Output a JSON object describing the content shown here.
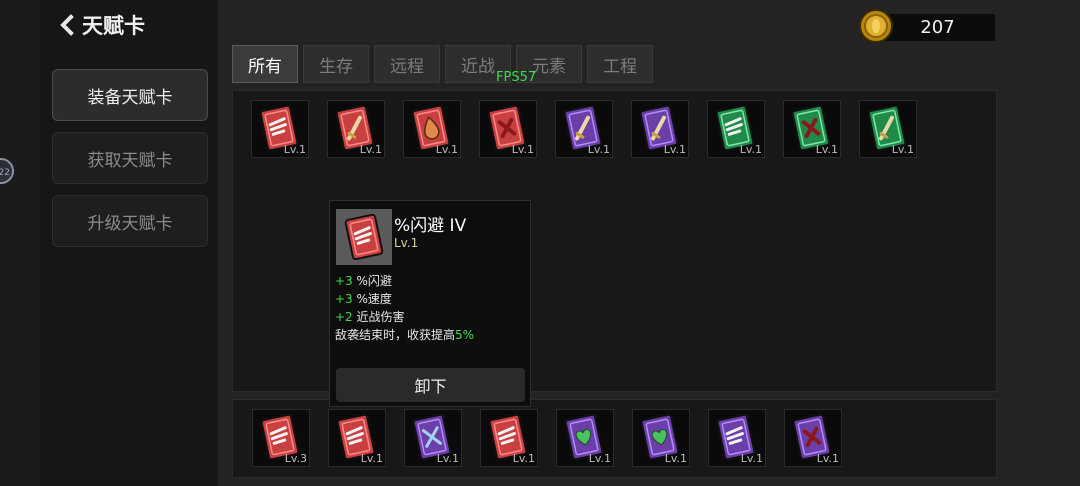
{
  "header": {
    "title": "天赋卡"
  },
  "currency": {
    "coins": "207"
  },
  "fps": "FPS57",
  "sidebar": {
    "items": [
      {
        "label": "装备天赋卡",
        "active": true
      },
      {
        "label": "获取天赋卡",
        "active": false
      },
      {
        "label": "升级天赋卡",
        "active": false
      }
    ]
  },
  "tabs": [
    {
      "label": "所有",
      "active": true
    },
    {
      "label": "生存",
      "active": false
    },
    {
      "label": "远程",
      "active": false
    },
    {
      "label": "近战",
      "active": false
    },
    {
      "label": "元素",
      "active": false
    },
    {
      "label": "工程",
      "active": false
    }
  ],
  "colors": {
    "red": "#c94040",
    "purple": "#6a3fa8",
    "green": "#1f8a4a",
    "accent_green": "#3fdc4a"
  },
  "inventory_cards": [
    {
      "color": "red",
      "icon": "wing-icon",
      "level": "Lv.1"
    },
    {
      "color": "red",
      "icon": "sword-icon",
      "level": "Lv.1"
    },
    {
      "color": "red",
      "icon": "drop-icon",
      "level": "Lv.1"
    },
    {
      "color": "red",
      "icon": "cross-icon",
      "level": "Lv.1"
    },
    {
      "color": "purple",
      "icon": "sword-icon",
      "level": "Lv.1"
    },
    {
      "color": "purple",
      "icon": "sword-icon",
      "level": "Lv.1"
    },
    {
      "color": "green",
      "icon": "wing-icon",
      "level": "Lv.1"
    },
    {
      "color": "green",
      "icon": "cross-icon",
      "level": "Lv.1"
    },
    {
      "color": "green",
      "icon": "sword-icon",
      "level": "Lv.1"
    }
  ],
  "equipped_cards": [
    {
      "color": "red",
      "icon": "wing-icon",
      "level": "Lv.3"
    },
    {
      "color": "red",
      "icon": "wing-icon",
      "level": "Lv.1"
    },
    {
      "color": "purple",
      "icon": "crossed-swords-icon",
      "level": "Lv.1"
    },
    {
      "color": "red",
      "icon": "wing-icon",
      "level": "Lv.1"
    },
    {
      "color": "purple",
      "icon": "heart-icon",
      "level": "Lv.1"
    },
    {
      "color": "purple",
      "icon": "heart-icon",
      "level": "Lv.1"
    },
    {
      "color": "purple",
      "icon": "wing-icon",
      "level": "Lv.1"
    },
    {
      "color": "purple",
      "icon": "cross-icon",
      "level": "Lv.1"
    }
  ],
  "tooltip": {
    "name": "%闪避 IV",
    "level": "Lv.1",
    "stats": [
      {
        "plus": "+3",
        "text": " %闪避"
      },
      {
        "plus": "+3",
        "text": " %速度"
      },
      {
        "plus": "+2",
        "text": " 近战伤害"
      }
    ],
    "effect_prefix": "敌袭结束时，收获提高",
    "effect_value": "5%",
    "button": "卸下"
  }
}
